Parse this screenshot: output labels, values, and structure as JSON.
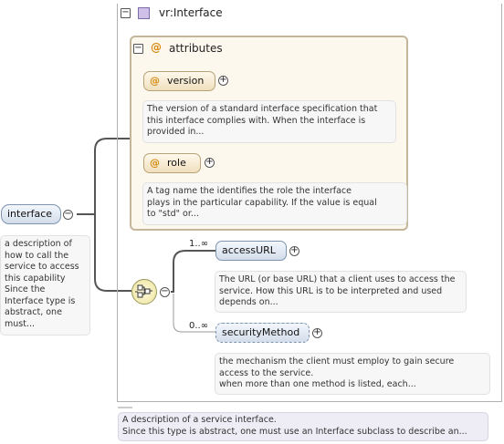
{
  "root": {
    "label": "interface",
    "doc": [
      "a description of",
      "how to call the",
      "service to access",
      "this capability",
      "Since the",
      "Interface type is",
      "abstract, one",
      "must..."
    ]
  },
  "type_box": {
    "title": "vr:Interface",
    "doc": [
      "A description of a service interface.",
      "Since this type is abstract, one must use an Interface subclass to describe an..."
    ]
  },
  "attributes": {
    "title": "attributes",
    "items": [
      {
        "name": "version",
        "doc": [
          "The version of a standard interface specification that",
          "this interface complies with. When the interface is",
          "provided in..."
        ]
      },
      {
        "name": "role",
        "doc": [
          "A tag name the identifies the role the interface",
          "plays in the particular capability. If the value is equal",
          "to \"std\" or..."
        ]
      }
    ]
  },
  "sequence": {
    "items": [
      {
        "name": "accessURL",
        "cardinality": "1..∞",
        "doc": [
          "The URL (or base URL) that a client uses to access the",
          "service. How this URL is to be interpreted and used",
          "depends on..."
        ]
      },
      {
        "name": "securityMethod",
        "cardinality": "0..∞",
        "doc": [
          "the mechanism the client must employ to gain secure",
          "access to the service.",
          "when more than one method is listed, each..."
        ]
      }
    ]
  },
  "symbols": {
    "collapse": "−",
    "expand": "+",
    "attr_marker": "@"
  },
  "colors": {
    "element_fill": "#d3ddea",
    "attribute_fill": "#efdfbd",
    "connector": "#555555",
    "attr_group_border": "#c4b69a"
  }
}
